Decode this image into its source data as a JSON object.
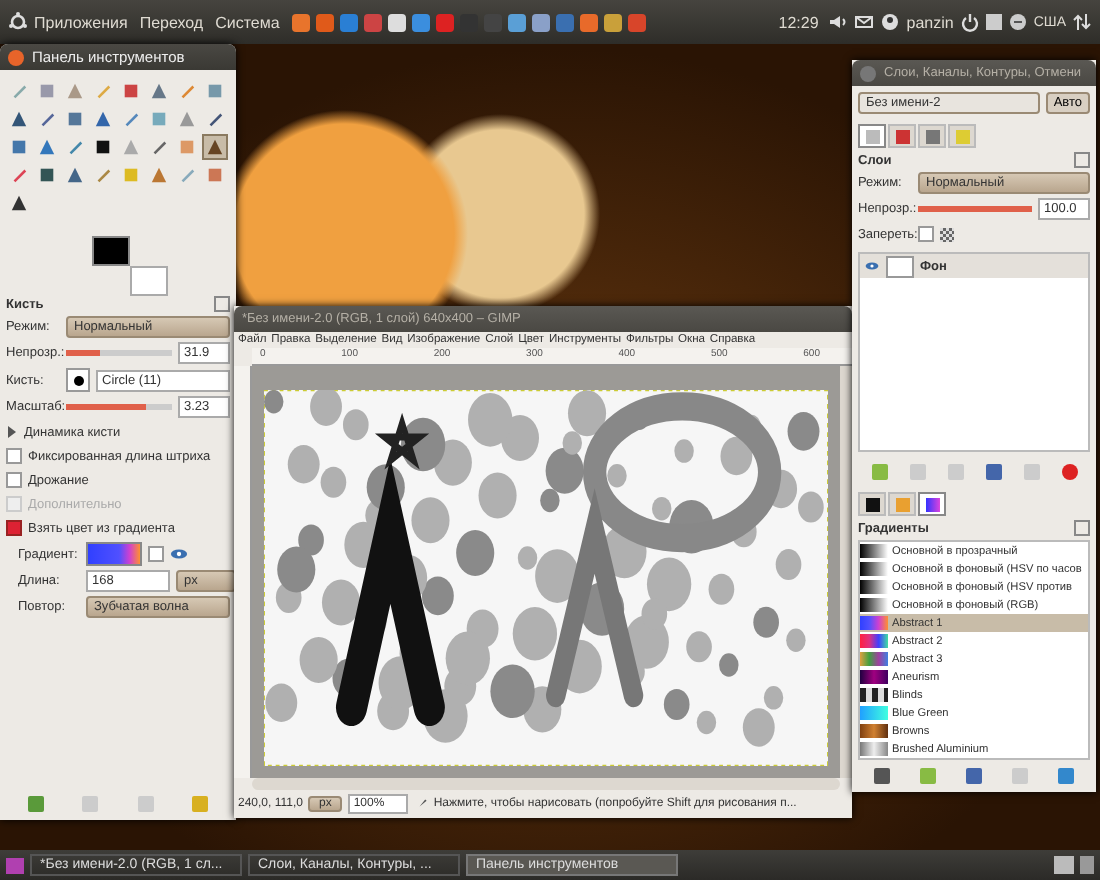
{
  "top_panel": {
    "menus": [
      "Приложения",
      "Переход",
      "Система"
    ],
    "clock": "12:29",
    "user": "panzin",
    "keyboard_layout": "США"
  },
  "toolbox": {
    "title": "Панель инструментов",
    "tools": [
      {
        "selected": false
      },
      {
        "selected": false
      },
      {
        "selected": false
      },
      {
        "selected": false
      },
      {
        "selected": false
      },
      {
        "selected": false
      },
      {
        "selected": false
      },
      {
        "selected": false
      },
      {
        "selected": false
      },
      {
        "selected": false
      },
      {
        "selected": false
      },
      {
        "selected": false
      },
      {
        "selected": false
      },
      {
        "selected": false
      },
      {
        "selected": false
      },
      {
        "selected": false
      },
      {
        "selected": false
      },
      {
        "selected": false
      },
      {
        "selected": false
      },
      {
        "selected": false
      },
      {
        "selected": false
      },
      {
        "selected": false
      },
      {
        "selected": false
      },
      {
        "selected": true
      },
      {
        "selected": false
      },
      {
        "selected": false
      },
      {
        "selected": false
      },
      {
        "selected": false
      },
      {
        "selected": false
      },
      {
        "selected": false
      },
      {
        "selected": false
      },
      {
        "selected": false
      },
      {
        "selected": false
      }
    ]
  },
  "tool_options": {
    "title": "Кисть",
    "mode": {
      "label": "Режим:",
      "value": "Нормальный"
    },
    "opacity": {
      "label": "Непрозр.:",
      "value": "31.9",
      "level": 0.319
    },
    "brush": {
      "label": "Кисть:",
      "value": "Circle (11)"
    },
    "scale": {
      "label": "Масштаб:",
      "value": "3.23",
      "level": 0.75
    },
    "dynamics": {
      "label": "Динамика кисти",
      "expanded": false
    },
    "checkboxes": [
      {
        "label": "Фиксированная длина штриха",
        "checked": false,
        "disabled": false
      },
      {
        "label": "Дрожание",
        "checked": false,
        "disabled": false
      },
      {
        "label": "Дополнительно",
        "checked": false,
        "disabled": true
      },
      {
        "label": "Взять цвет из градиента",
        "checked": true,
        "disabled": false
      }
    ],
    "gradient": {
      "label": "Градиент:",
      "reverse": false
    },
    "length": {
      "label": "Длина:",
      "value": "168",
      "unit": "px"
    },
    "repeat": {
      "label": "Повтор:",
      "value": "Зубчатая волна"
    }
  },
  "image_window": {
    "title": "*Без имени-2.0 (RGB, 1 слой) 640x400 – GIMP",
    "menu": [
      "Файл",
      "Правка",
      "Выделение",
      "Вид",
      "Изображение",
      "Слой",
      "Цвет",
      "Инструменты",
      "Фильтры",
      "Окна",
      "Справка"
    ],
    "ruler_ticks": [
      "0",
      "100",
      "200",
      "300",
      "400",
      "500",
      "600"
    ],
    "status": {
      "coords": "240,0, 111,0",
      "unit": "px",
      "zoom": "100%",
      "message": "Нажмите, чтобы нарисовать (попробуйте Shift для рисования п..."
    }
  },
  "dock": {
    "title": "Слои, Каналы, Контуры, Отмени",
    "image": "Без имени-2",
    "auto": "Авто",
    "tabs": [
      {
        "selected": true
      },
      {
        "selected": false
      },
      {
        "selected": false
      },
      {
        "selected": false
      }
    ],
    "layers": {
      "title": "Слои",
      "mode_label": "Режим:",
      "mode": "Нормальный",
      "opacity_label": "Непрозр.:",
      "opacity": "100.0",
      "level": 1.0,
      "lock_label": "Запереть:",
      "lock_alpha": false,
      "items": [
        {
          "name": "Фон",
          "visible": true
        }
      ]
    },
    "resource_tabs": [
      {
        "selected": false
      },
      {
        "selected": false
      },
      {
        "selected": true
      }
    ],
    "gradients": {
      "title": "Градиенты",
      "items": [
        {
          "name": "Основной в прозрачный",
          "selected": false
        },
        {
          "name": "Основной в фоновый (HSV по часов",
          "selected": false
        },
        {
          "name": "Основной в фоновый (HSV против",
          "selected": false
        },
        {
          "name": "Основной в фоновый (RGB)",
          "selected": false
        },
        {
          "name": "Abstract 1",
          "selected": true
        },
        {
          "name": "Abstract 2",
          "selected": false
        },
        {
          "name": "Abstract 3",
          "selected": false
        },
        {
          "name": "Aneurism",
          "selected": false
        },
        {
          "name": "Blinds",
          "selected": false
        },
        {
          "name": "Blue Green",
          "selected": false
        },
        {
          "name": "Browns",
          "selected": false
        },
        {
          "name": "Brushed Aluminium",
          "selected": false
        }
      ]
    }
  },
  "taskbar": {
    "items": [
      {
        "label": "*Без имени-2.0 (RGB, 1 сл...",
        "selected": false
      },
      {
        "label": "Слои, Каналы, Контуры, ...",
        "selected": false
      },
      {
        "label": "Панель инструментов",
        "selected": true
      }
    ]
  }
}
